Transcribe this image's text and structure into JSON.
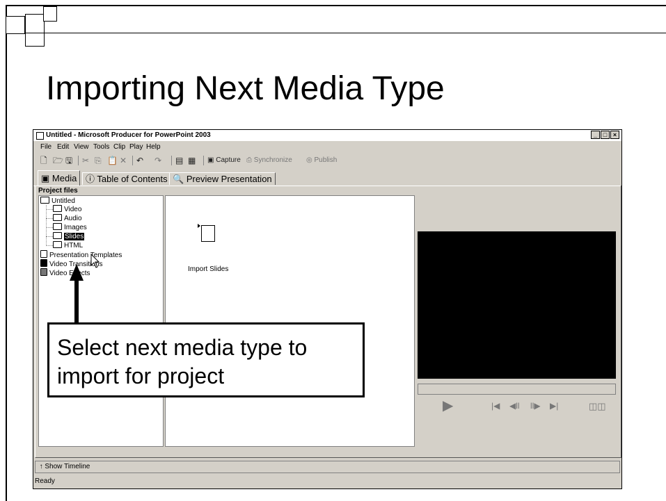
{
  "slide": {
    "title": "Importing Next Media Type"
  },
  "window": {
    "title": "Untitled - Microsoft Producer for PowerPoint 2003",
    "min": "_",
    "max": "□",
    "close": "×"
  },
  "menu": {
    "file": "File",
    "edit": "Edit",
    "view": "View",
    "tools": "Tools",
    "clip": "Clip",
    "play": "Play",
    "help": "Help"
  },
  "toolbar": {
    "capture": "Capture",
    "synchronize": "Synchronize",
    "publish": "Publish"
  },
  "tabs": {
    "media": "Media",
    "toc": "Table of Contents",
    "preview": "Preview Presentation"
  },
  "project": {
    "label": "Project files",
    "root": "Untitled",
    "folders": [
      "Video",
      "Audio",
      "Images",
      "Slides",
      "HTML"
    ],
    "templates": "Presentation Templates",
    "transitions": "Video Transitions",
    "effects": "Video Effects"
  },
  "content": {
    "import_label": "Import Slides"
  },
  "bottom": {
    "show_timeline": "Show Timeline",
    "status": "Ready"
  },
  "callout": {
    "line1": "Select next media type to",
    "line2": "import for project"
  },
  "colors": {
    "window_bg": "#d4d0c8",
    "preview_bg": "#000000",
    "selection": "#000000"
  }
}
